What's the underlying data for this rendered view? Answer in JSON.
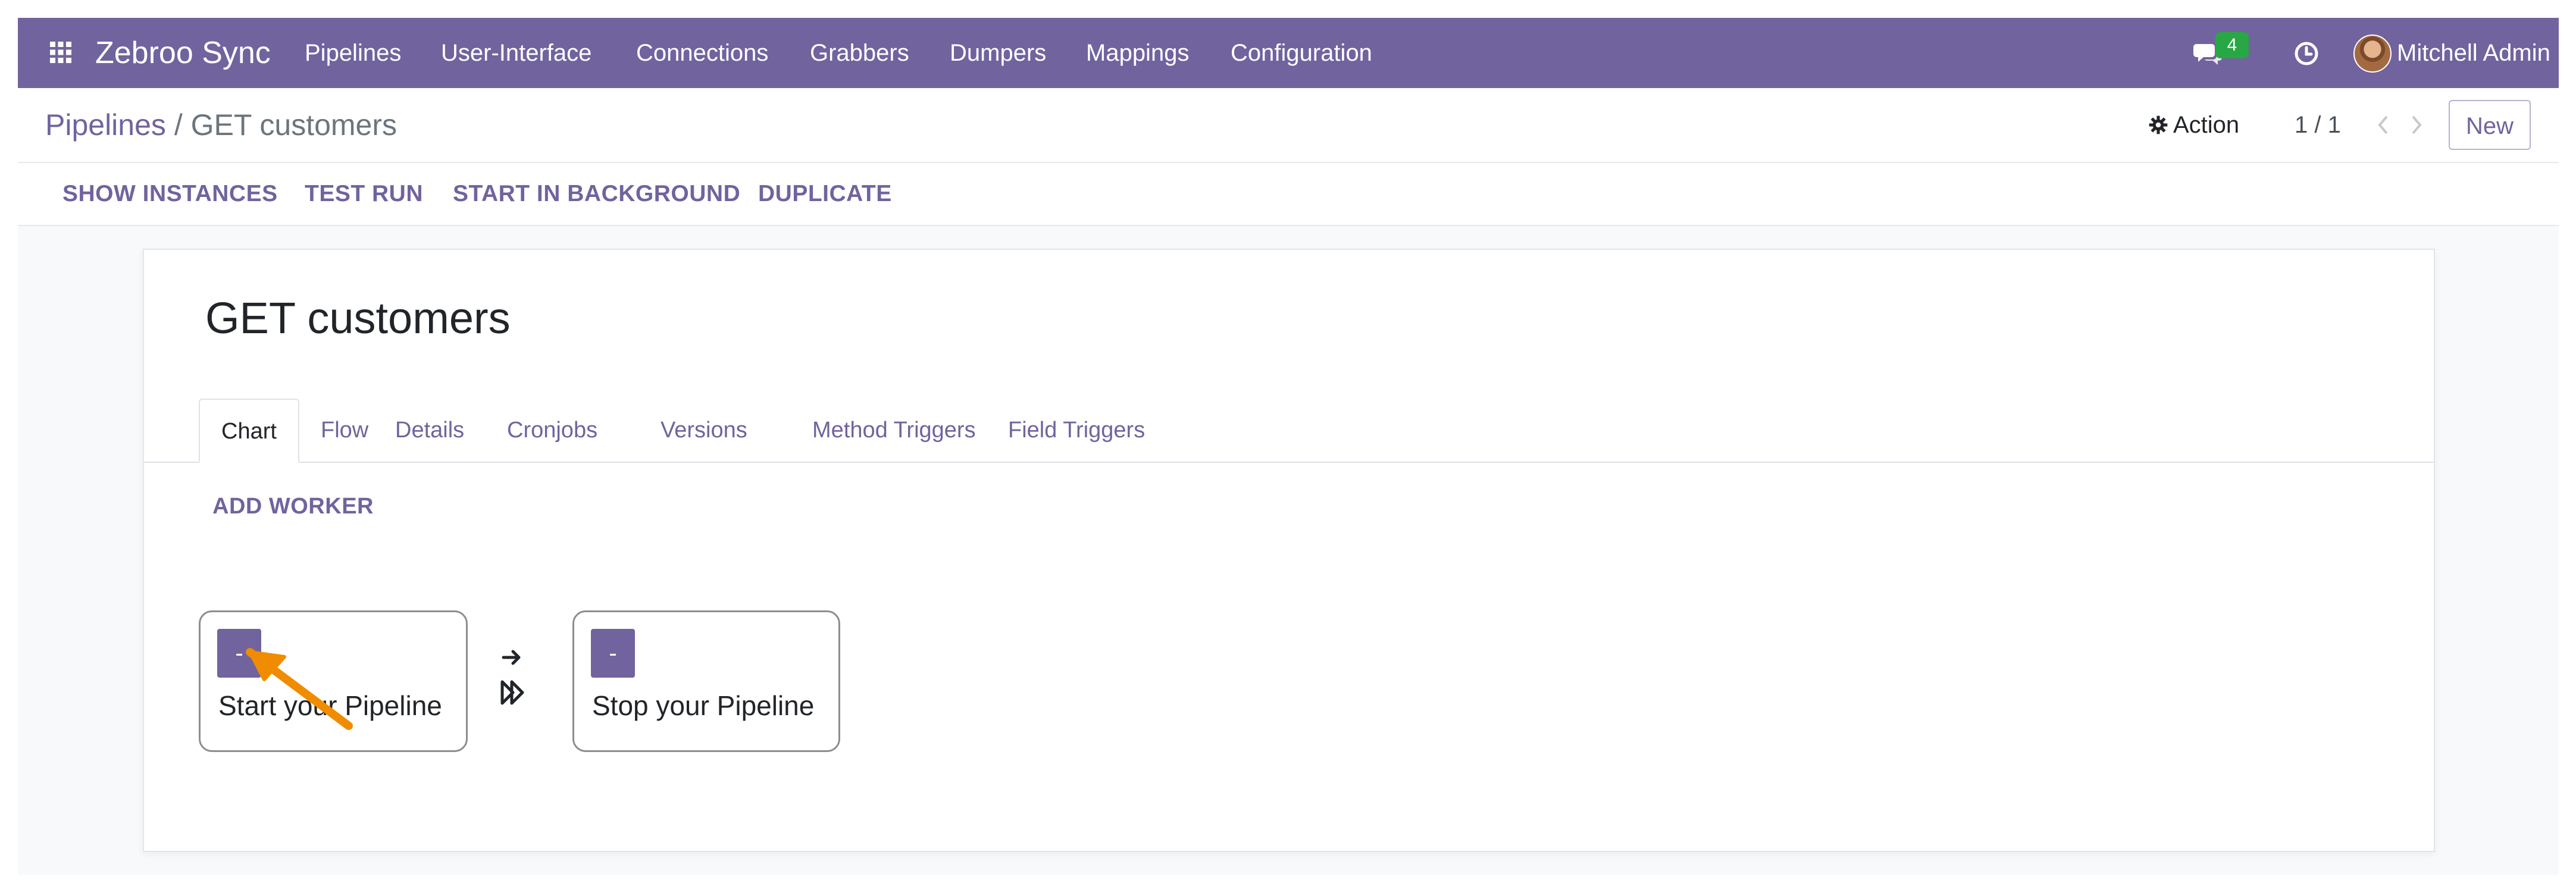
{
  "navbar": {
    "brand": "Zebroo Sync",
    "menu": [
      "Pipelines",
      "User-Interface",
      "Connections",
      "Grabbers",
      "Dumpers",
      "Mappings",
      "Configuration"
    ],
    "message_count": "4",
    "user_name": "Mitchell Admin",
    "icons": [
      "apps-grid-icon",
      "chat-icon",
      "clock-icon"
    ]
  },
  "control_panel": {
    "breadcrumb_parent": "Pipelines",
    "breadcrumb_separator": "/",
    "breadcrumb_current": "GET customers",
    "action_label": "Action",
    "pager_value": "1 / 1",
    "new_label": "New"
  },
  "button_bar": [
    "SHOW INSTANCES",
    "TEST RUN",
    "START IN BACKGROUND",
    "DUPLICATE"
  ],
  "form": {
    "title": "GET customers",
    "tabs": [
      "Chart",
      "Flow",
      "Details",
      "Cronjobs",
      "Versions",
      "Method Triggers",
      "Field Triggers"
    ],
    "active_tab": "Chart",
    "add_worker_label": "ADD WORKER",
    "nodes": [
      {
        "toggle": "-",
        "label": "Start your Pipeline"
      },
      {
        "toggle": "-",
        "label": "Stop your Pipeline"
      }
    ]
  },
  "colors": {
    "brand": "#71639e",
    "badge": "#28a745",
    "cursor": "#f08c00"
  }
}
